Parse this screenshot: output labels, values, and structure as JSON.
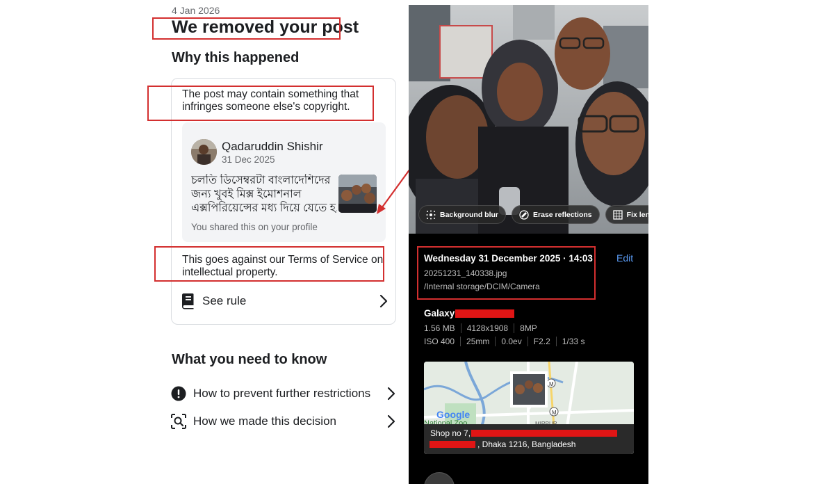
{
  "notice": {
    "date": "4 Jan 2026",
    "title": "We removed your post",
    "why_heading": "Why this happened",
    "reason_text": "The post may contain something that infringes someone else's copyright.",
    "post": {
      "author": "Qadaruddin Shishir",
      "date": "31 Dec 2025",
      "text_lines": [
        "চলতি ডিসেম্বরটা বাংলাদেশিদের",
        "জন্য খুবই মিক্স ইমোশনাল",
        "এক্সপিরিয়েন্সের মধ্য দিয়ে যেতে হ..."
      ],
      "shared_text": "You shared this on your profile"
    },
    "terms_text": "This goes against our Terms of Service on intellectual property.",
    "see_rule_label": "See rule",
    "need_heading": "What you need to know",
    "links": [
      {
        "label": "How to prevent further restrictions",
        "icon": "exclamation-circle-icon"
      },
      {
        "label": "How we made this decision",
        "icon": "scan-search-icon"
      }
    ]
  },
  "photo_details": {
    "chips": [
      {
        "label": "Background blur",
        "icon": "blur-icon"
      },
      {
        "label": "Erase reflections",
        "icon": "eraser-icon"
      },
      {
        "label": "Fix lens dis",
        "icon": "lens-icon"
      }
    ],
    "datetime": "Wednesday 31 December 2025 · 14:03",
    "edit_label": "Edit",
    "filename": "20251231_140338.jpg",
    "path": "/Internal storage/DCIM/Camera",
    "device": "Galaxy",
    "specs_row1": [
      "1.56 MB",
      "4128x1908",
      "8MP"
    ],
    "specs_row2": [
      "ISO 400",
      "25mm",
      "0.0ev",
      "F2.2",
      "1/33 s"
    ],
    "map": {
      "logo": "Google",
      "place_label": "National Zoo",
      "area_label": "MIRPUR",
      "metro_icon": "M"
    },
    "address_line1": "Shop no 7,",
    "address_line2": ", Dhaka 1216, Bangladesh"
  },
  "colors": {
    "annotation_red": "#d32f2f",
    "redaction_red": "#e01515",
    "edit_blue": "#5b9cf6"
  }
}
